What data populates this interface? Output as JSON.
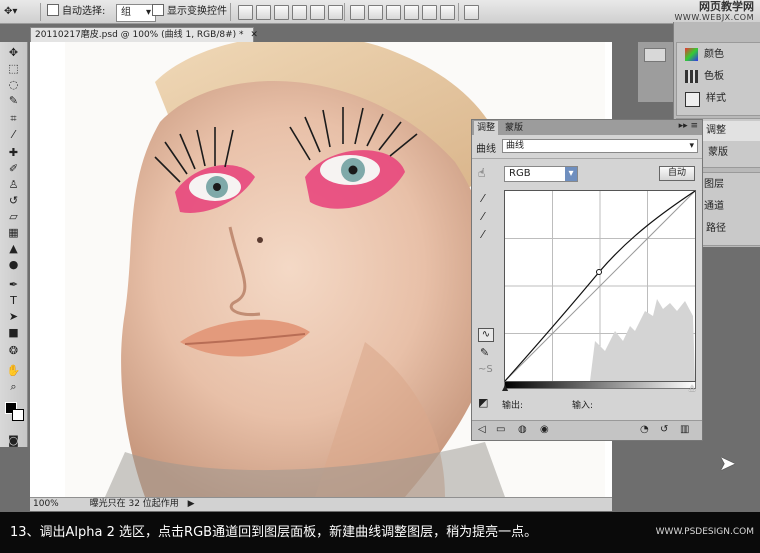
{
  "options_bar": {
    "auto_select_label": "自动选择:",
    "auto_select_value": "组",
    "show_transform_label": "显示变换控件"
  },
  "watermark": {
    "line1": "网页教学网",
    "line2": "WWW.WEBJX.COM"
  },
  "document": {
    "tab_title": "20110217磨皮.psd @ 100% (曲线 1, RGB/8#) *",
    "zoom": "100%",
    "status_text": "曝光只在 32 位起作用"
  },
  "dock": {
    "items": [
      {
        "label": "颜色",
        "icon": "color-icon"
      },
      {
        "label": "色板",
        "icon": "swatches-icon"
      },
      {
        "label": "样式",
        "icon": "styles-icon"
      },
      {
        "label": "调整",
        "icon": "adjustments-icon"
      },
      {
        "label": "蒙版",
        "icon": "masks-icon"
      },
      {
        "label": "图层",
        "icon": "layers-icon"
      },
      {
        "label": "通道",
        "icon": "channels-icon"
      },
      {
        "label": "路径",
        "icon": "paths-icon"
      }
    ]
  },
  "adjust_panel": {
    "tabs": [
      "调整",
      "蒙版"
    ],
    "type_label": "曲线",
    "preset_value": "曲线",
    "channel_value": "RGB",
    "auto_button": "自动",
    "output_label": "输出:",
    "input_label": "输入:"
  },
  "caption": {
    "text": "13、调出Alpha 2 选区，点击RGB通道回到图层面板，新建曲线调整图层，稍为提亮一点。",
    "watermark": "WWW.PSDESIGN.COM"
  },
  "colors": {
    "accent_pink": "#e8407a",
    "panel_bg": "#d4d4d4",
    "caption_bg": "#0a0a0a"
  }
}
